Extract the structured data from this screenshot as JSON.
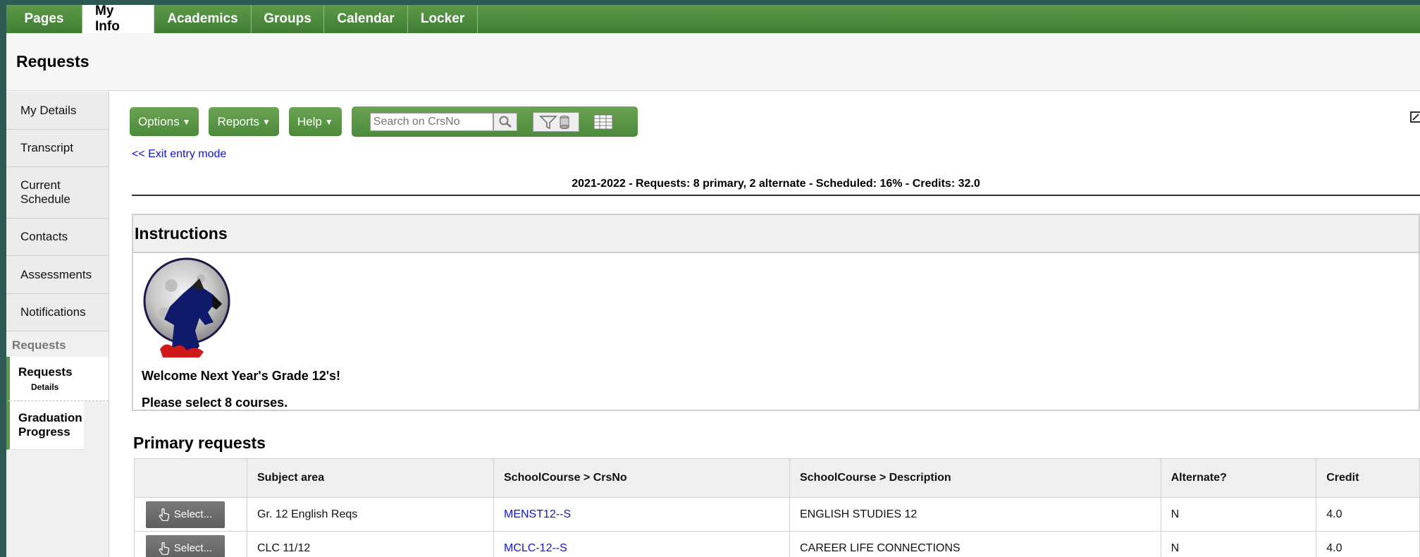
{
  "top_tabs": [
    "Pages",
    "My Info",
    "Academics",
    "Groups",
    "Calendar",
    "Locker"
  ],
  "page_title": "Requests",
  "side_nav": {
    "items": [
      "My Details",
      "Transcript",
      "Current Schedule",
      "Contacts",
      "Assessments",
      "Notifications"
    ],
    "section_header": "Requests",
    "sub_active": "Requests",
    "sub_active_detail": "Details",
    "sub_second": "Graduation Progress"
  },
  "toolbar": {
    "options": "Options",
    "reports": "Reports",
    "help": "Help",
    "search_placeholder": "Search on CrsNo"
  },
  "exit_link": "<< Exit entry mode",
  "summary": "2021-2022 - Requests: 8 primary, 2 alternate - Scheduled: 16% - Credits: 32.0",
  "instructions": {
    "title": "Instructions",
    "welcome": "Welcome Next Year's Grade 12's!",
    "select_prompt": "Please select 8 courses."
  },
  "primary_title": "Primary requests",
  "table": {
    "headers": [
      "",
      "Subject area",
      "SchoolCourse > CrsNo",
      "SchoolCourse > Description",
      "Alternate?",
      "Credit"
    ],
    "select_label": "Select...",
    "rows": [
      {
        "subject": "Gr. 12 English Reqs",
        "crsno": "MENST12--S",
        "desc": "ENGLISH STUDIES 12",
        "alt": "N",
        "credit": "4.0"
      },
      {
        "subject": "CLC 11/12",
        "crsno": "MCLC-12--S",
        "desc": "CAREER LIFE CONNECTIONS",
        "alt": "N",
        "credit": "4.0"
      }
    ]
  }
}
